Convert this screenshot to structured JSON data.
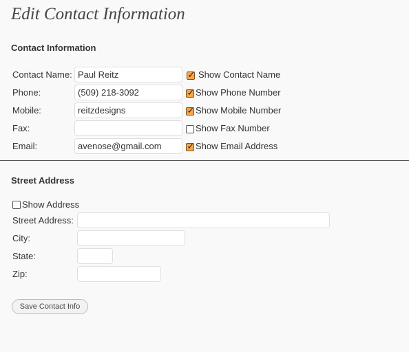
{
  "page": {
    "title": "Edit Contact Information"
  },
  "contact": {
    "heading": "Contact Information",
    "rows": [
      {
        "label": "Contact Name:",
        "value": "Paul Reitz",
        "show_label": "Show Contact Name",
        "checked": true
      },
      {
        "label": "Phone:",
        "value": "(509) 218-3092",
        "show_label": "Show Phone Number",
        "checked": true
      },
      {
        "label": "Mobile:",
        "value": "reitzdesigns",
        "show_label": "Show Mobile Number",
        "checked": true
      },
      {
        "label": "Fax:",
        "value": "",
        "show_label": "Show Fax Number",
        "checked": false
      },
      {
        "label": "Email:",
        "value": "avenose@gmail.com",
        "show_label": "Show Email Address",
        "checked": true
      }
    ]
  },
  "address": {
    "heading": "Street Address",
    "show_label": "Show Address",
    "show_checked": false,
    "fields": [
      {
        "label": "Street Address:",
        "value": ""
      },
      {
        "label": "City:",
        "value": ""
      },
      {
        "label": "State:",
        "value": ""
      },
      {
        "label": "Zip:",
        "value": ""
      }
    ]
  },
  "actions": {
    "save_label": "Save Contact Info"
  },
  "colors": {
    "checkbox_checked": "#f6a64a",
    "background": "#f9f9f9"
  }
}
